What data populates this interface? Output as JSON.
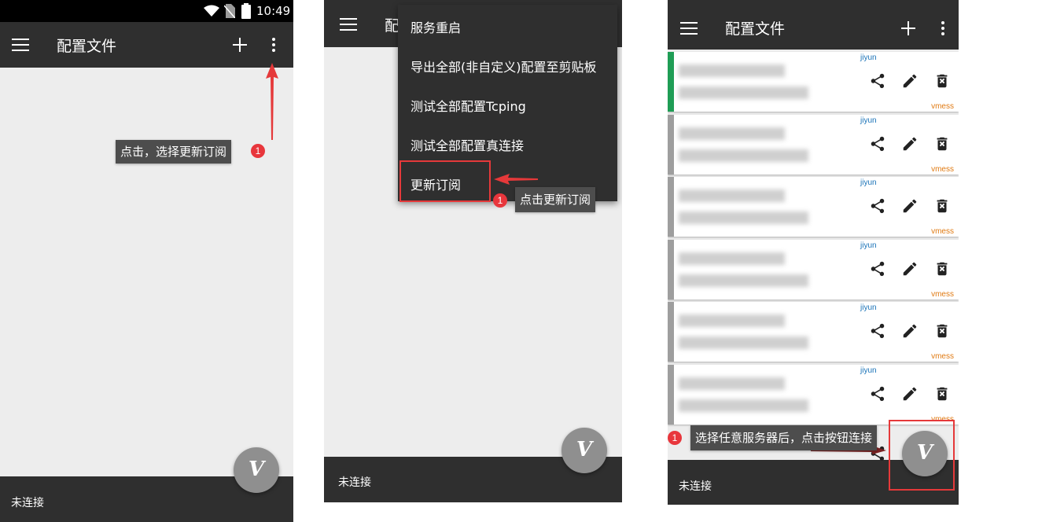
{
  "panel1": {
    "status_bar": {
      "time": "10:49"
    },
    "toolbar": {
      "title": "配置文件"
    },
    "bottom_status": "未连接",
    "annotation": {
      "badge": "1",
      "text": "点击，选择更新订阅"
    }
  },
  "panel2": {
    "toolbar": {
      "title": "配置文件"
    },
    "menu": {
      "items": [
        {
          "label": "服务重启"
        },
        {
          "label": "导出全部(非自定义)配置至剪贴板"
        },
        {
          "label": "测试全部配置Tcping"
        },
        {
          "label": "测试全部配置真连接"
        },
        {
          "label": "更新订阅"
        }
      ]
    },
    "bottom_status": "未连接",
    "annotation": {
      "badge": "1",
      "text": "点击更新订阅"
    }
  },
  "panel3": {
    "toolbar": {
      "title": "配置文件"
    },
    "profiles": [
      {
        "group": "jiyun",
        "type": "vmess",
        "active": true
      },
      {
        "group": "jiyun",
        "type": "vmess",
        "active": false
      },
      {
        "group": "jiyun",
        "type": "vmess",
        "active": false
      },
      {
        "group": "jiyun",
        "type": "vmess",
        "active": false
      },
      {
        "group": "jiyun",
        "type": "vmess",
        "active": false
      },
      {
        "group": "jiyun",
        "type": "vmess",
        "active": false
      }
    ],
    "bottom_status": "未连接",
    "annotation": {
      "badge": "1",
      "text": "选择任意服务器后，点击按钮连接"
    }
  },
  "fab_glyph": "V",
  "colors": {
    "toolbar": "#2f2f2f",
    "accent_active": "#1f9d55",
    "annotation_red": "#e5393a",
    "group_tag": "#1a73b8",
    "type_tag": "#e07a12"
  },
  "icons": {
    "menu": "hamburger-icon",
    "add": "plus-icon",
    "more": "more-vert-icon",
    "share": "share-icon",
    "edit": "edit-icon",
    "delete": "delete-icon"
  }
}
